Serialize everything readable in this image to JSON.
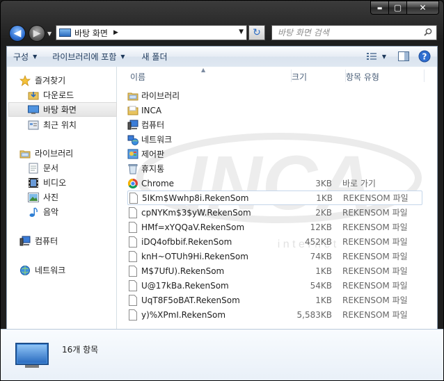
{
  "window": {
    "caption": {
      "minimize": "▬",
      "maximize": "▢",
      "close": "✕"
    }
  },
  "address": {
    "location": "바탕 화면"
  },
  "search": {
    "placeholder": "바탕 화면 검색"
  },
  "toolbar": {
    "organize": "구성",
    "include_in_library": "라이브러리에 포함",
    "new_folder": "새 폴더"
  },
  "navpane": {
    "favorites": {
      "label": "즐겨찾기",
      "items": [
        {
          "label": "다운로드",
          "icon": "download-folder-icon"
        },
        {
          "label": "바탕 화면",
          "icon": "desktop-icon"
        },
        {
          "label": "최근 위치",
          "icon": "recent-places-icon"
        }
      ]
    },
    "libraries": {
      "label": "라이브러리",
      "items": [
        {
          "label": "문서",
          "icon": "documents-icon"
        },
        {
          "label": "비디오",
          "icon": "videos-icon"
        },
        {
          "label": "사진",
          "icon": "pictures-icon"
        },
        {
          "label": "음악",
          "icon": "music-icon"
        }
      ]
    },
    "computer": {
      "label": "컴퓨터"
    },
    "network": {
      "label": "네트워크"
    }
  },
  "columns": {
    "name": "이름",
    "size": "크기",
    "type": "항목 유형"
  },
  "files": [
    {
      "name": "라이브러리",
      "size": "",
      "type": "",
      "icon": "library-folder-icon"
    },
    {
      "name": "INCA",
      "size": "",
      "type": "",
      "icon": "folder-icon"
    },
    {
      "name": "컴퓨터",
      "size": "",
      "type": "",
      "icon": "computer-icon"
    },
    {
      "name": "네트워크",
      "size": "",
      "type": "",
      "icon": "network-icon"
    },
    {
      "name": "제어판",
      "size": "",
      "type": "",
      "icon": "control-panel-icon"
    },
    {
      "name": "휴지통",
      "size": "",
      "type": "",
      "icon": "recycle-bin-icon"
    },
    {
      "name": "Chrome",
      "size": "3KB",
      "type": "바로 가기",
      "icon": "chrome-icon"
    },
    {
      "name": "5IKm$Wwhp8i.RekenSom",
      "size": "1KB",
      "type": "REKENSOM 파일",
      "icon": "file-icon"
    },
    {
      "name": "cpNYKm$3$yW.RekenSom",
      "size": "2KB",
      "type": "REKENSOM 파일",
      "icon": "file-icon"
    },
    {
      "name": "HMf=xYQQaV.RekenSom",
      "size": "12KB",
      "type": "REKENSOM 파일",
      "icon": "file-icon"
    },
    {
      "name": "iDQ4ofbbif.RekenSom",
      "size": "452KB",
      "type": "REKENSOM 파일",
      "icon": "file-icon"
    },
    {
      "name": "knH~OTUh9Hi.RekenSom",
      "size": "74KB",
      "type": "REKENSOM 파일",
      "icon": "file-icon"
    },
    {
      "name": "M$7UfU).RekenSom",
      "size": "1KB",
      "type": "REKENSOM 파일",
      "icon": "file-icon"
    },
    {
      "name": "U@17kBa.RekenSom",
      "size": "54KB",
      "type": "REKENSOM 파일",
      "icon": "file-icon"
    },
    {
      "name": "UqT8F5oBAT.RekenSom",
      "size": "1KB",
      "type": "REKENSOM 파일",
      "icon": "file-icon"
    },
    {
      "name": "y)%XPmI.RekenSom",
      "size": "5,583KB",
      "type": "REKENSOM 파일",
      "icon": "file-icon"
    }
  ],
  "watermark": {
    "text": "INCA",
    "sub": "i n t e r n e t"
  },
  "details": {
    "count": "16개 항목"
  },
  "colors": {
    "accent": "#2c6cc4",
    "selection": "#c4d6ea",
    "toolbar_text": "#1e395b"
  }
}
